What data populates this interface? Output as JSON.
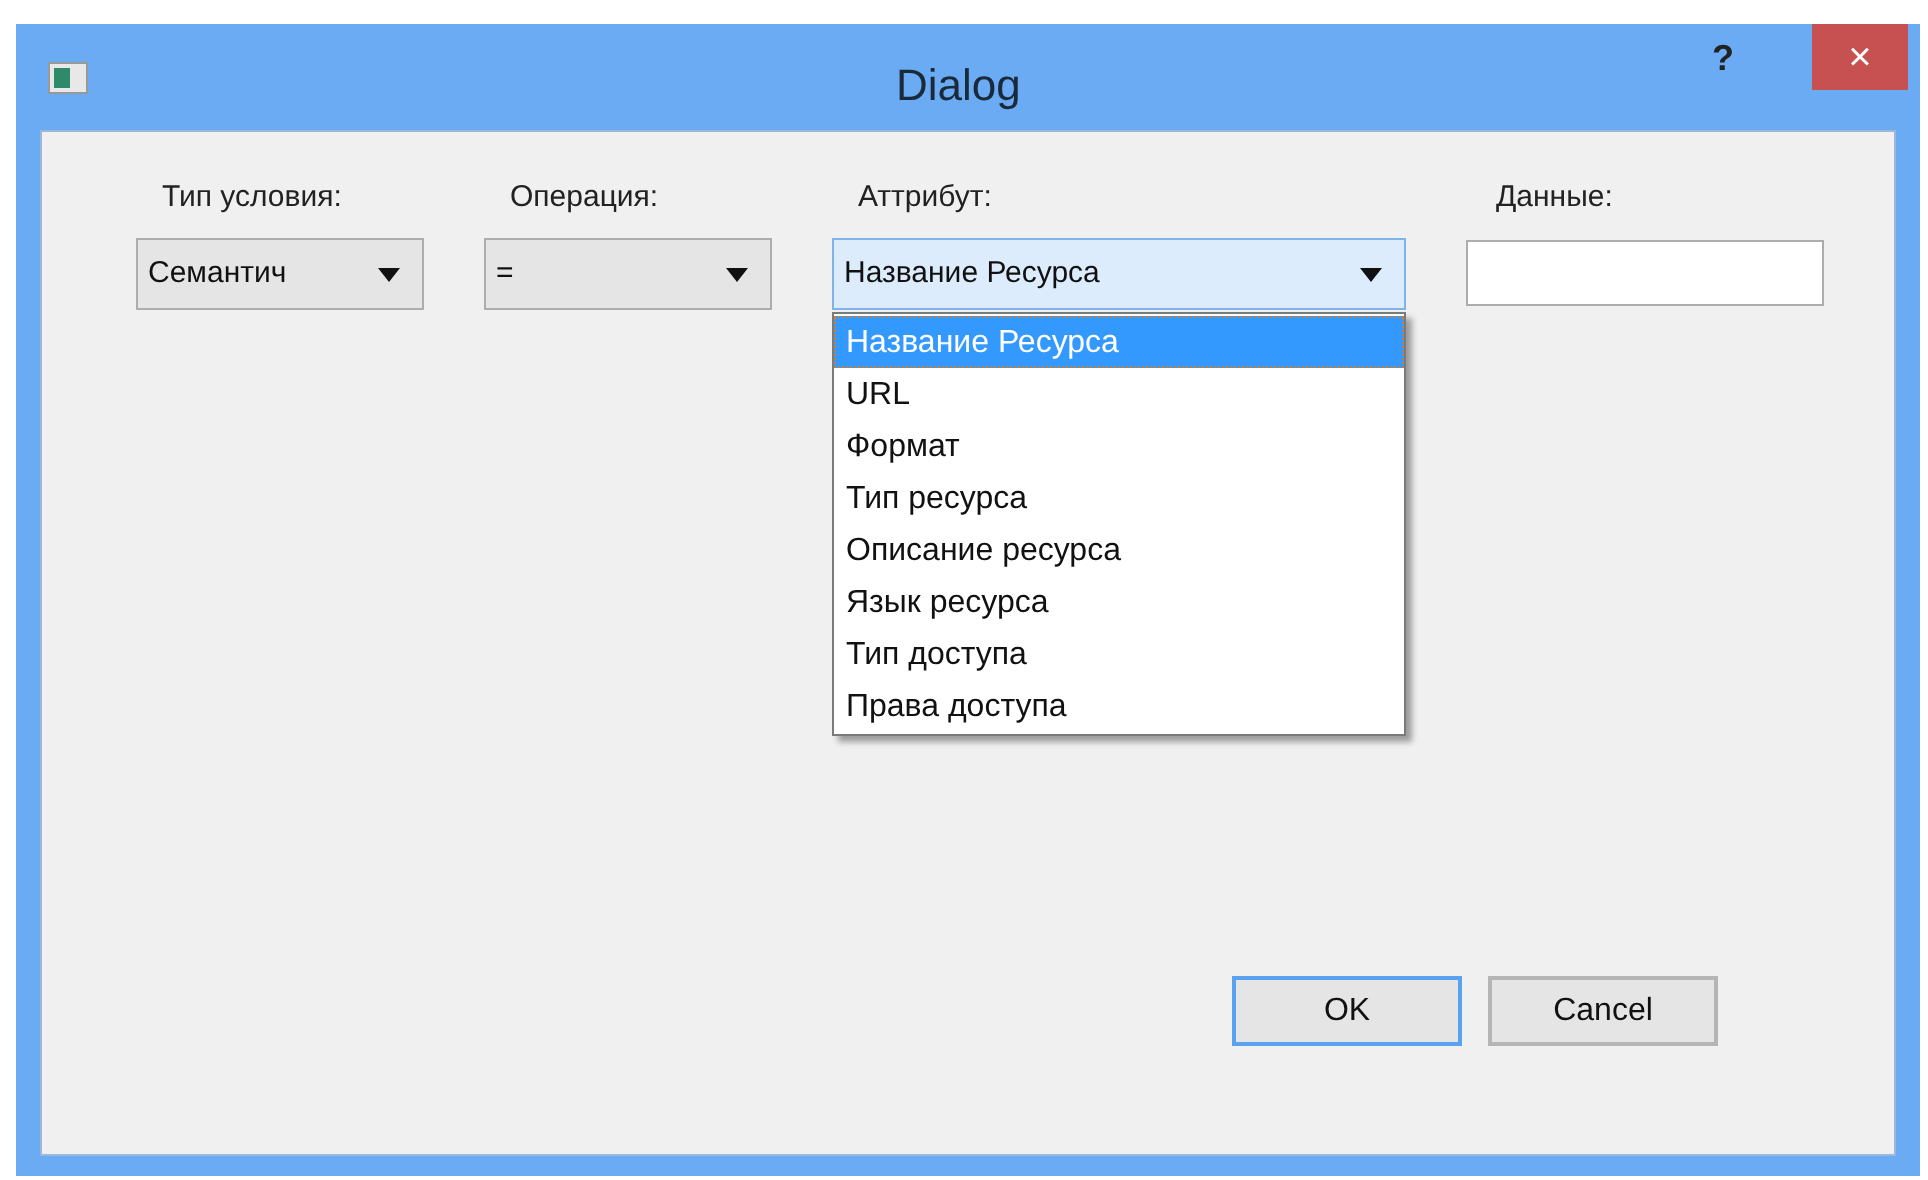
{
  "window": {
    "title": "Dialog",
    "help": "?",
    "close": "×"
  },
  "fields": [
    {
      "label": "Тип условия:",
      "kind": "combo",
      "value": "Семантич",
      "focused": false
    },
    {
      "label": "Операция:",
      "kind": "combo",
      "value": "=",
      "focused": false
    },
    {
      "label": "Аттрибут:",
      "kind": "combo",
      "value": "Название Ресурса",
      "focused": true
    },
    {
      "label": "Данные:",
      "kind": "text"
    }
  ],
  "dropdown": {
    "items": [
      {
        "label": "Название Ресурса",
        "selected": true
      },
      {
        "label": "URL",
        "selected": false
      },
      {
        "label": "Формат",
        "selected": false
      },
      {
        "label": "Тип ресурса",
        "selected": false
      },
      {
        "label": "Описание ресурса",
        "selected": false
      },
      {
        "label": "Язык ресурса",
        "selected": false
      },
      {
        "label": "Тип доступа",
        "selected": false
      },
      {
        "label": "Права доступа",
        "selected": false
      }
    ]
  },
  "buttons": [
    {
      "label": "OK",
      "default": true
    },
    {
      "label": "Cancel",
      "default": false
    }
  ]
}
